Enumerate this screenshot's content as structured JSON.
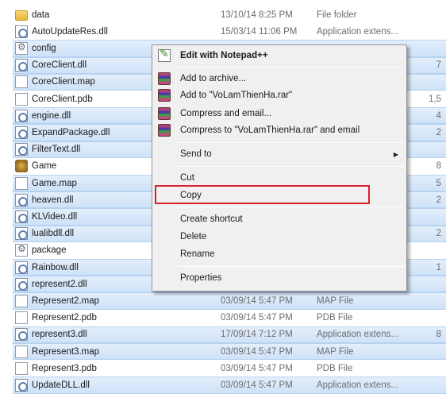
{
  "files": [
    {
      "name": "data",
      "date": "13/10/14 8:25 PM",
      "type": "File folder",
      "size": "",
      "icon": "folder-icon",
      "selected": false
    },
    {
      "name": "AutoUpdateRes.dll",
      "date": "15/03/14 11:06 PM",
      "type": "Application extens...",
      "size": "",
      "icon": "dll-icon",
      "selected": false
    },
    {
      "name": "config",
      "date": "",
      "type": "",
      "size": "",
      "icon": "config-file-icon",
      "selected": true
    },
    {
      "name": "CoreClient.dll",
      "date": "",
      "type": "",
      "size": "7",
      "icon": "dll-icon",
      "selected": true
    },
    {
      "name": "CoreClient.map",
      "date": "",
      "type": "",
      "size": "",
      "icon": "file-icon",
      "selected": true
    },
    {
      "name": "CoreClient.pdb",
      "date": "",
      "type": "",
      "size": "1,5",
      "icon": "file-icon",
      "selected": false
    },
    {
      "name": "engine.dll",
      "date": "",
      "type": "",
      "size": "4",
      "icon": "dll-icon",
      "selected": true
    },
    {
      "name": "ExpandPackage.dll",
      "date": "",
      "type": "",
      "size": "2",
      "icon": "dll-icon",
      "selected": true
    },
    {
      "name": "FilterText.dll",
      "date": "",
      "type": "",
      "size": "",
      "icon": "dll-icon",
      "selected": true
    },
    {
      "name": "Game",
      "date": "",
      "type": "",
      "size": "8",
      "icon": "game-icon",
      "selected": false
    },
    {
      "name": "Game.map",
      "date": "",
      "type": "",
      "size": "5",
      "icon": "file-icon",
      "selected": true
    },
    {
      "name": "heaven.dll",
      "date": "",
      "type": "",
      "size": "2",
      "icon": "dll-icon",
      "selected": true
    },
    {
      "name": "KLVideo.dll",
      "date": "",
      "type": "",
      "size": "",
      "icon": "dll-icon",
      "selected": true
    },
    {
      "name": "lualibdll.dll",
      "date": "",
      "type": "",
      "size": "2",
      "icon": "dll-icon",
      "selected": true
    },
    {
      "name": "package",
      "date": "",
      "type": "",
      "size": "",
      "icon": "config-file-icon",
      "selected": false
    },
    {
      "name": "Rainbow.dll",
      "date": "",
      "type": "",
      "size": "1",
      "icon": "dll-icon",
      "selected": true
    },
    {
      "name": "represent2.dll",
      "date": "",
      "type": "",
      "size": "",
      "icon": "dll-icon",
      "selected": true
    },
    {
      "name": "Represent2.map",
      "date": "03/09/14 5:47 PM",
      "type": "MAP File",
      "size": "",
      "icon": "file-icon",
      "selected": true
    },
    {
      "name": "Represent2.pdb",
      "date": "03/09/14 5:47 PM",
      "type": "PDB File",
      "size": "",
      "icon": "file-icon",
      "selected": false
    },
    {
      "name": "represent3.dll",
      "date": "17/09/14 7:12 PM",
      "type": "Application extens...",
      "size": "8",
      "icon": "dll-icon",
      "selected": true
    },
    {
      "name": "Represent3.map",
      "date": "03/09/14 5:47 PM",
      "type": "MAP File",
      "size": "",
      "icon": "file-icon",
      "selected": true
    },
    {
      "name": "Represent3.pdb",
      "date": "03/09/14 5:47 PM",
      "type": "PDB File",
      "size": "",
      "icon": "file-icon",
      "selected": false
    },
    {
      "name": "UpdateDLL.dll",
      "date": "03/09/14 5:47 PM",
      "type": "Application extens...",
      "size": "",
      "icon": "dll-icon",
      "selected": true
    }
  ],
  "context_menu": {
    "edit_notepad": "Edit with Notepad++",
    "add_archive": "Add to archive...",
    "add_to_rar": "Add to \"VoLamThienHa.rar\"",
    "compress_email": "Compress and email...",
    "compress_to_rar_email": "Compress to \"VoLamThienHa.rar\" and email",
    "send_to": "Send to",
    "cut": "Cut",
    "copy": "Copy",
    "create_shortcut": "Create shortcut",
    "delete": "Delete",
    "rename": "Rename",
    "properties": "Properties"
  },
  "colors": {
    "highlight_box": "#d9232e",
    "selection": "#cfe2f8"
  }
}
